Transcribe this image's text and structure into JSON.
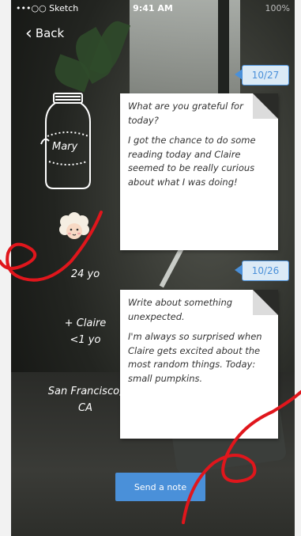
{
  "status_bar": {
    "carrier": "•••○○ Sketch",
    "time": "9:41 AM",
    "battery": "100%"
  },
  "nav": {
    "back_label": "Back",
    "back_icon": "chevron-left-icon"
  },
  "profile": {
    "name": "Mary",
    "age": "24 yo",
    "companion": "+ Claire",
    "companion_age": "<1 yo",
    "city": "San Francisco,",
    "state": "CA"
  },
  "entries": [
    {
      "date": "10/27",
      "prompt": "What are you grateful for today?",
      "answer": "I got the chance to do some reading today and Claire seemed to be really curious about what I was doing!"
    },
    {
      "date": "10/26",
      "prompt": "Write about something unexpected.",
      "answer": "I'm always so surprised when Claire gets excited about the most random things. Today: small pumpkins."
    }
  ],
  "actions": {
    "send_note_label": "Send a note"
  },
  "colors": {
    "accent": "#4a90d9",
    "scribble": "#e0161c",
    "card": "#ffffff"
  }
}
